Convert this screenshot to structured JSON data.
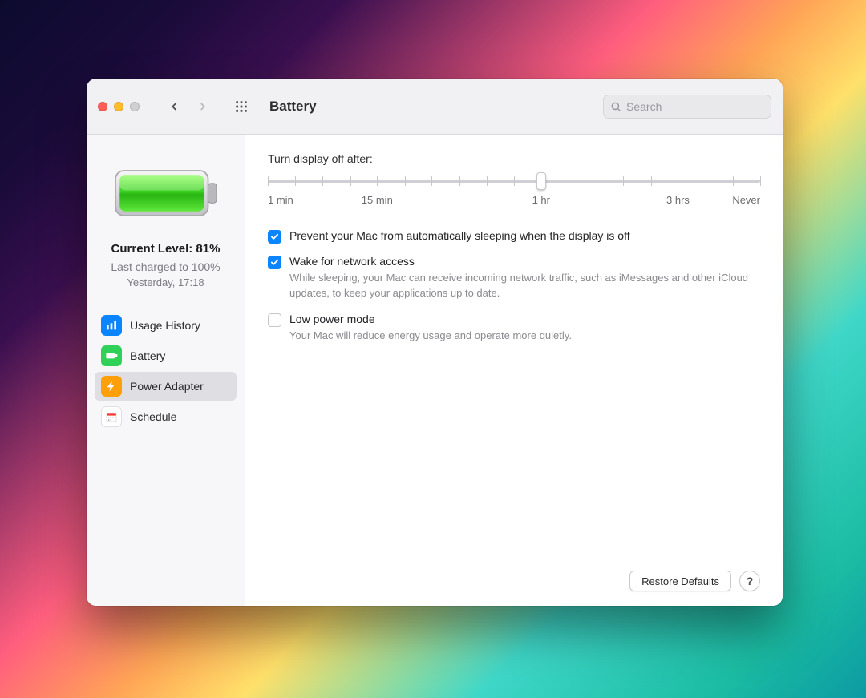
{
  "window": {
    "title": "Battery"
  },
  "toolbar": {
    "back_enabled": true,
    "forward_enabled": false,
    "search_placeholder": "Search"
  },
  "sidebar": {
    "status": {
      "level_label": "Current Level: 81%",
      "last_charged": "Last charged to 100%",
      "when": "Yesterday, 17:18"
    },
    "items": [
      {
        "id": "usage-history",
        "label": "Usage History",
        "icon": "chart-bar-icon",
        "icon_color": "ic-blue",
        "selected": false
      },
      {
        "id": "battery",
        "label": "Battery",
        "icon": "battery-icon",
        "icon_color": "ic-green",
        "selected": false
      },
      {
        "id": "power-adapter",
        "label": "Power Adapter",
        "icon": "bolt-icon",
        "icon_color": "ic-orange",
        "selected": true
      },
      {
        "id": "schedule",
        "label": "Schedule",
        "icon": "calendar-icon",
        "icon_color": "ic-white",
        "selected": false
      }
    ]
  },
  "main": {
    "display_off": {
      "label": "Turn display off after:",
      "ticks": [
        {
          "pos": 0,
          "label": "1 min"
        },
        {
          "pos": 5.55
        },
        {
          "pos": 11.1
        },
        {
          "pos": 16.7
        },
        {
          "pos": 22.2,
          "label": "15 min"
        },
        {
          "pos": 27.8
        },
        {
          "pos": 33.3
        },
        {
          "pos": 38.9
        },
        {
          "pos": 44.4
        },
        {
          "pos": 50.0
        },
        {
          "pos": 55.5,
          "label": "1 hr"
        },
        {
          "pos": 61.1
        },
        {
          "pos": 66.7
        },
        {
          "pos": 72.2
        },
        {
          "pos": 77.8
        },
        {
          "pos": 83.3,
          "label": "3 hrs"
        },
        {
          "pos": 88.9
        },
        {
          "pos": 94.4
        },
        {
          "pos": 100,
          "label": "Never"
        }
      ],
      "thumb_pos": 55.5
    },
    "options": [
      {
        "id": "prevent-sleep",
        "checked": true,
        "label": "Prevent your Mac from automatically sleeping when the display is off",
        "description": ""
      },
      {
        "id": "wake-network",
        "checked": true,
        "label": "Wake for network access",
        "description": "While sleeping, your Mac can receive incoming network traffic, such as iMessages and other iCloud updates, to keep your applications up to date."
      },
      {
        "id": "low-power",
        "checked": false,
        "label": "Low power mode",
        "description": "Your Mac will reduce energy usage and operate more quietly."
      }
    ],
    "footer": {
      "restore_label": "Restore Defaults",
      "help_label": "?"
    }
  }
}
